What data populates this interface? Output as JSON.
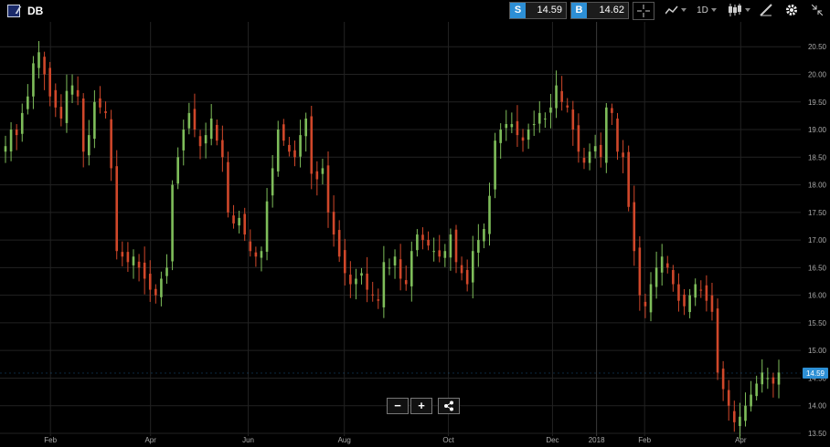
{
  "header": {
    "symbol": "DB",
    "sell_tag": "S",
    "sell_price": "14.59",
    "buy_tag": "B",
    "buy_price": "14.62",
    "interval": "1D",
    "icons": [
      "crosshair-icon",
      "indicators-icon",
      "candlestick-icon",
      "drawing-icon",
      "settings-icon",
      "collapse-icon"
    ]
  },
  "zoom": {
    "minus": "−",
    "plus": "+"
  },
  "colors": {
    "up": "#7ebd5a",
    "down": "#d0472a",
    "grid": "#222222",
    "axis_text": "#aaaaaa",
    "current": "#2d8fd5"
  },
  "chart_data": {
    "type": "candlestick",
    "x_labels": [
      "Feb",
      "Apr",
      "Jun",
      "Aug",
      "Oct",
      "Dec",
      "2018",
      "Feb",
      "Apr"
    ],
    "y_ticks": [
      "20.50",
      "20.00",
      "19.50",
      "19.00",
      "18.50",
      "18.00",
      "17.50",
      "17.00",
      "16.50",
      "16.00",
      "15.50",
      "15.00",
      "14.50",
      "14.00",
      "13.50"
    ],
    "ylim": [
      13.45,
      20.95
    ],
    "current_price": "14.59",
    "close_series": [
      18.7,
      19.0,
      18.9,
      19.3,
      19.6,
      20.2,
      20.4,
      20.0,
      19.6,
      19.4,
      19.2,
      19.7,
      19.8,
      19.6,
      18.6,
      18.9,
      19.5,
      19.4,
      19.3,
      18.3,
      16.8,
      16.7,
      16.6,
      16.7,
      16.5,
      16.3,
      16.1,
      16.0,
      16.3,
      16.5,
      18.0,
      18.5,
      19.0,
      19.3,
      19.0,
      18.7,
      18.9,
      19.2,
      18.8,
      18.5,
      17.5,
      17.3,
      17.4,
      17.1,
      16.8,
      16.7,
      16.8,
      17.7,
      18.3,
      19.0,
      18.8,
      18.6,
      18.5,
      18.9,
      19.2,
      18.2,
      18.1,
      18.3,
      17.5,
      17.1,
      16.7,
      16.4,
      16.2,
      16.3,
      16.4,
      16.1,
      16.0,
      15.9,
      16.6,
      16.5,
      16.7,
      16.3,
      16.2,
      16.8,
      17.1,
      17.0,
      16.9,
      16.8,
      16.7,
      16.8,
      17.1,
      16.6,
      16.4,
      16.2,
      16.8,
      17.0,
      17.2,
      17.8,
      18.8,
      19.0,
      19.1,
      19.1,
      18.9,
      18.8,
      19.0,
      19.1,
      19.3,
      19.2,
      19.4,
      19.8,
      19.5,
      19.4,
      19.0,
      18.6,
      18.4,
      18.6,
      18.7,
      18.5,
      19.4,
      19.3,
      18.6,
      18.5,
      17.6,
      16.8,
      16.0,
      15.8,
      16.2,
      16.5,
      16.7,
      16.5,
      16.2,
      15.9,
      15.8,
      16.0,
      16.2,
      16.1,
      15.9,
      15.7,
      14.6,
      14.3,
      14.0,
      13.7,
      13.8,
      14.0,
      14.2,
      14.4,
      14.6,
      14.5,
      14.4,
      14.6
    ]
  }
}
